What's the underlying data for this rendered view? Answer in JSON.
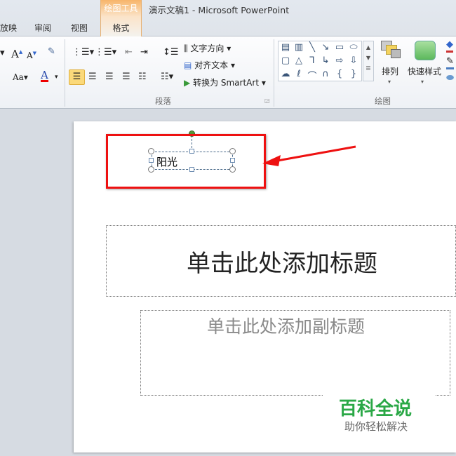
{
  "window": {
    "title": "演示文稿1  -  Microsoft PowerPoint"
  },
  "context_tab": {
    "group": "绘图工具",
    "tab": "格式"
  },
  "tabs": [
    "放映",
    "审阅",
    "视图"
  ],
  "ribbon": {
    "paragraph": {
      "label": "段落",
      "text_direction": "文字方向",
      "align_text": "对齐文本",
      "convert_smartart": "转换为 SmartArt"
    },
    "drawing": {
      "label": "绘图",
      "arrange": "排列",
      "quick_styles": "快速样式"
    }
  },
  "slide": {
    "textbox_text": "阳光",
    "title_placeholder": "单击此处添加标题",
    "subtitle_placeholder": "单击此处添加副标题"
  },
  "watermark": {
    "title": "百科全说",
    "subtitle": "助你轻松解决"
  },
  "colors": {
    "highlight": "#ee1111",
    "accent_tab": "#f7b56a"
  }
}
